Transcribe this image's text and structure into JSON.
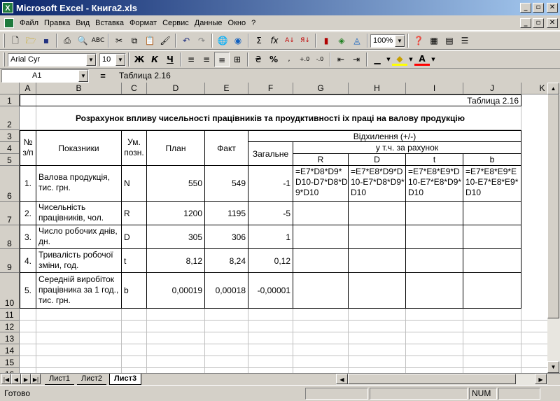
{
  "window": {
    "title": "Microsoft Excel - Книга2.xls",
    "app_icon_letter": "X",
    "minimize": "_",
    "restore": "▫",
    "close": "✕"
  },
  "menu": [
    "Файл",
    "Правка",
    "Вид",
    "Вставка",
    "Формат",
    "Сервис",
    "Данные",
    "Окно",
    "?"
  ],
  "toolbar": {
    "zoom": "100%",
    "font": "Arial Cyr",
    "size": "10",
    "bold": "Ж",
    "italic": "К",
    "underline": "Ч",
    "percent": "%",
    "sum": "Σ",
    "fx": "fx",
    "currency_icon": "₴"
  },
  "formula_bar": {
    "name_box": "A1",
    "equals": "=",
    "content": "Таблица 2.16"
  },
  "columns": [
    "A",
    "B",
    "C",
    "D",
    "E",
    "F",
    "G",
    "H",
    "I",
    "J",
    "K"
  ],
  "rows": [
    "1",
    "2",
    "3",
    "4",
    "5",
    "6",
    "7",
    "8",
    "9",
    "10",
    "11",
    "12",
    "13",
    "14",
    "15",
    "16"
  ],
  "sheet": {
    "table_label": "Таблица 2.16",
    "title": "Розрахунок впливу чисельності працівників та проудктивності іх праці на валову продукцію",
    "h_num": "№ з/п",
    "h_ind": "Показники",
    "h_unit": "Ум. позн.",
    "h_plan": "План",
    "h_fact": "Факт",
    "h_dev": "Відхилення (+/-)",
    "h_total": "Загальне",
    "h_incl": "у т.ч. за рахунок",
    "h_R": "R",
    "h_D": "D",
    "h_t": "t",
    "h_b": "b",
    "data_rows": [
      {
        "n": "1.",
        "name": "Валова продукція, тис. грн.",
        "u": "N",
        "plan": "550",
        "fact": "549",
        "total": "-1",
        "g": "=E7*D8*D9*D10-D7*D8*D9*D10",
        "h": "=E7*E8*D9*D10-E7*D8*D9*D10",
        "i": "=E7*E8*E9*D10-E7*E8*D9*D10",
        "j": "=E7*E8*E9*E10-E7*E8*E9*D10"
      },
      {
        "n": "2.",
        "name": "Чисельність працівників, чол.",
        "u": "R",
        "plan": "1200",
        "fact": "1195",
        "total": "-5"
      },
      {
        "n": "3.",
        "name": "Число робочих днів, дн.",
        "u": "D",
        "plan": "305",
        "fact": "306",
        "total": "1"
      },
      {
        "n": "4.",
        "name": "Тривалість робочої зміни, год.",
        "u": "t",
        "plan": "8,12",
        "fact": "8,24",
        "total": "0,12"
      },
      {
        "n": "5.",
        "name": "Середній виробіток працівника за 1 год., тис. грн.",
        "u": "b",
        "plan": "0,00019",
        "fact": "0,00018",
        "total": "-0,00001"
      }
    ]
  },
  "tabs": [
    "Лист1",
    "Лист2",
    "Лист3"
  ],
  "status": {
    "ready": "Готово",
    "num": "NUM"
  }
}
